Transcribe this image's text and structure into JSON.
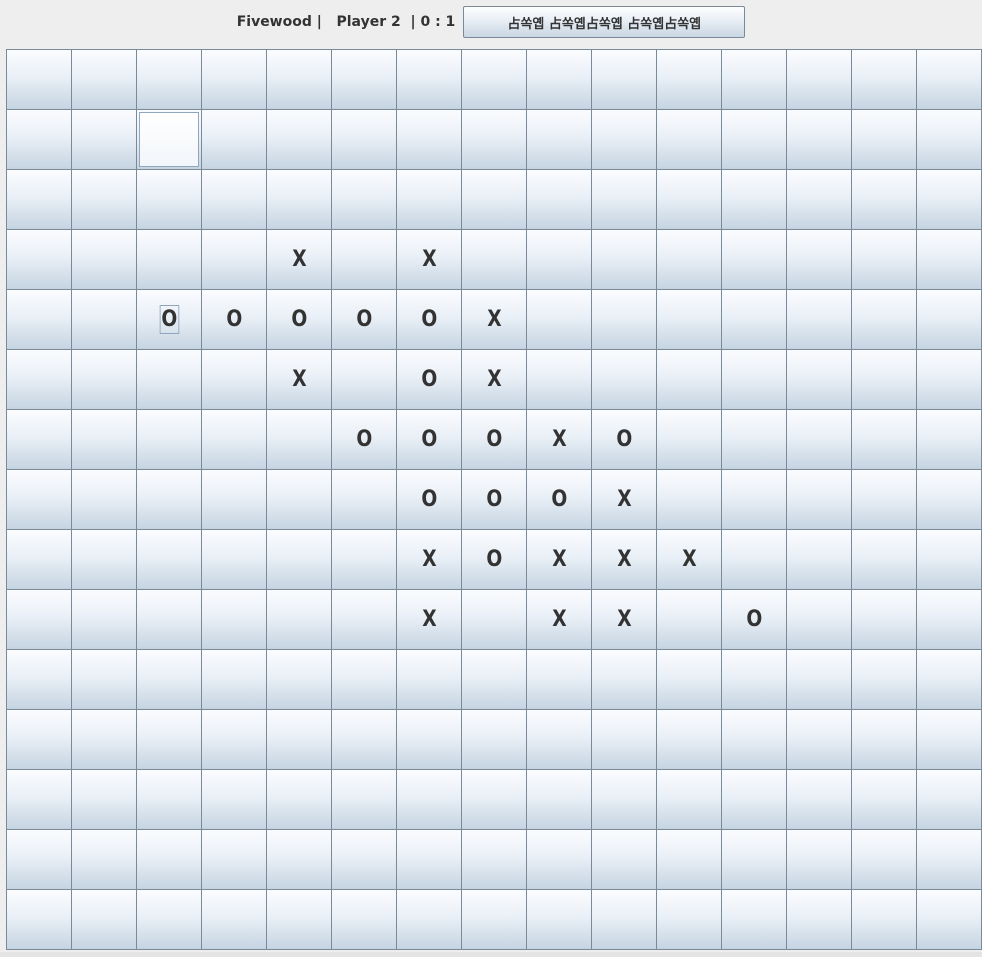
{
  "header": {
    "game_name": "Fivewood |",
    "player": "Player 2",
    "score": "| 0 : 1",
    "new_game_label": "占쏙옙 占쏙옙占쏙옙 占쏙옙占쏙옙"
  },
  "board": {
    "rows": 15,
    "cols": 15,
    "cells": [
      [
        "",
        "",
        "",
        "",
        "",
        "",
        "",
        "",
        "",
        "",
        "",
        "",
        "",
        "",
        ""
      ],
      [
        "",
        "",
        "",
        "",
        "",
        "",
        "",
        "",
        "",
        "",
        "",
        "",
        "",
        "",
        ""
      ],
      [
        "",
        "",
        "",
        "",
        "",
        "",
        "",
        "",
        "",
        "",
        "",
        "",
        "",
        "",
        ""
      ],
      [
        "",
        "",
        "",
        "",
        "X",
        "",
        "X",
        "",
        "",
        "",
        "",
        "",
        "",
        "",
        ""
      ],
      [
        "",
        "",
        "O",
        "O",
        "O",
        "O",
        "O",
        "X",
        "",
        "",
        "",
        "",
        "",
        "",
        ""
      ],
      [
        "",
        "",
        "",
        "",
        "X",
        "",
        "O",
        "X",
        "",
        "",
        "",
        "",
        "",
        "",
        ""
      ],
      [
        "",
        "",
        "",
        "",
        "",
        "O",
        "O",
        "O",
        "X",
        "O",
        "",
        "",
        "",
        "",
        ""
      ],
      [
        "",
        "",
        "",
        "",
        "",
        "",
        "O",
        "O",
        "O",
        "X",
        "",
        "",
        "",
        "",
        ""
      ],
      [
        "",
        "",
        "",
        "",
        "",
        "",
        "X",
        "O",
        "X",
        "X",
        "X",
        "",
        "",
        "",
        ""
      ],
      [
        "",
        "",
        "",
        "",
        "",
        "",
        "X",
        "",
        "X",
        "X",
        "",
        "O",
        "",
        "",
        ""
      ],
      [
        "",
        "",
        "",
        "",
        "",
        "",
        "",
        "",
        "",
        "",
        "",
        "",
        "",
        "",
        ""
      ],
      [
        "",
        "",
        "",
        "",
        "",
        "",
        "",
        "",
        "",
        "",
        "",
        "",
        "",
        "",
        ""
      ],
      [
        "",
        "",
        "",
        "",
        "",
        "",
        "",
        "",
        "",
        "",
        "",
        "",
        "",
        "",
        ""
      ],
      [
        "",
        "",
        "",
        "",
        "",
        "",
        "",
        "",
        "",
        "",
        "",
        "",
        "",
        "",
        ""
      ],
      [
        "",
        "",
        "",
        "",
        "",
        "",
        "",
        "",
        "",
        "",
        "",
        "",
        "",
        "",
        ""
      ]
    ],
    "focused_cell": [
      1,
      2
    ],
    "focused_mark": [
      4,
      2
    ]
  },
  "colors": {
    "border": "#7a8a99",
    "mark": "#333333"
  }
}
